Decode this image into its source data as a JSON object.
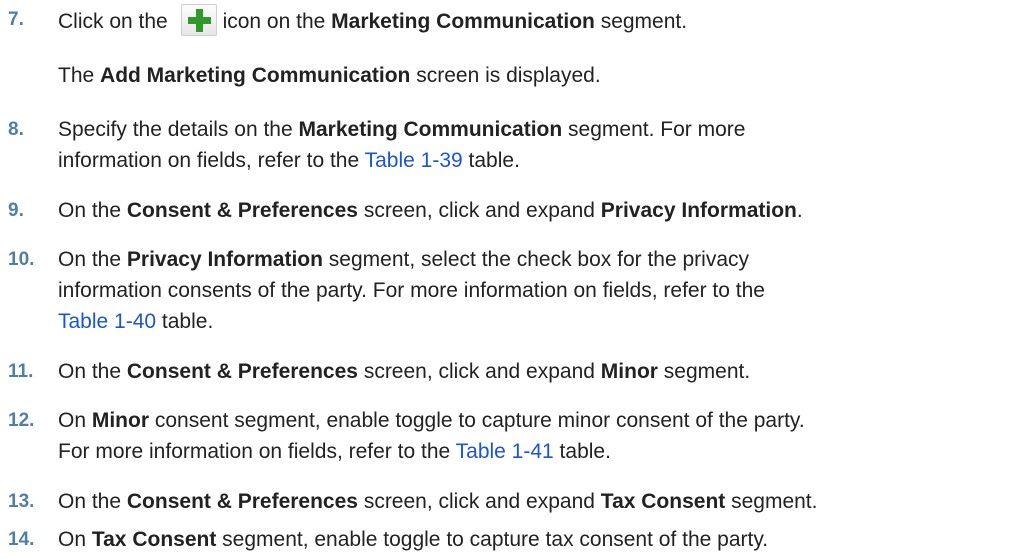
{
  "steps": [
    {
      "num": "7.",
      "a": "Click on the ",
      "b": "icon on the ",
      "c": "Marketing Communication",
      "d": " segment.",
      "icon": "plus-icon",
      "sub_a": "The ",
      "sub_b": "Add Marketing Communication",
      "sub_c": " screen is displayed."
    },
    {
      "num": "8.",
      "a": "Specify the details on the ",
      "b": "Marketing Communication",
      "c": " segment. For more",
      "d": "information on fields, refer to the ",
      "link": "Table 1-39",
      "e": " table."
    },
    {
      "num": "9.",
      "a": "On the ",
      "b": "Consent & Preferences",
      "c": " screen, click and expand ",
      "d": "Privacy Information",
      "e": "."
    },
    {
      "num": "10.",
      "a": "On the ",
      "b": "Privacy Information",
      "c": " segment, select the check box for the privacy",
      "d": "information consents of the party. For more information on fields, refer to the",
      "link": "Table 1-40",
      "e": " table."
    },
    {
      "num": "11.",
      "a": "On the ",
      "b": "Consent & Preferences",
      "c": " screen, click and expand ",
      "d": "Minor",
      "e": " segment."
    },
    {
      "num": "12.",
      "a": "On ",
      "b": "Minor",
      "c": " consent segment, enable toggle to capture minor consent of the party.",
      "d": "For more information on fields, refer to the ",
      "link": "Table 1-41",
      "e": " table."
    },
    {
      "num": "13.",
      "a": "On the ",
      "b": "Consent & Preferences",
      "c": " screen, click and expand ",
      "d": "Tax Consent",
      "e": " segment."
    },
    {
      "num": "14.",
      "a": "On ",
      "b": "Tax Consent",
      "c": " segment, enable toggle to capture tax consent of the party."
    }
  ]
}
